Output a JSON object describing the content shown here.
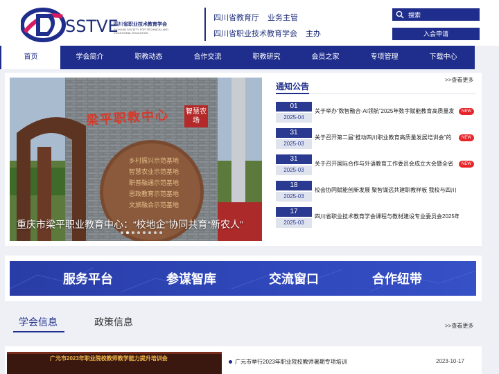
{
  "header": {
    "logo_word": "SSTVE",
    "logo_cn": "四川省职业技术教育学会",
    "logo_en": "SICHUAN SOCIETY FOR TECHNICAL AND VOCATIONAL EDUCATION",
    "line1_org": "四川省教育厅",
    "line1_rel": "业务主管",
    "line2_org": "四川省职业技术教育学会",
    "line2_rel": "主办",
    "search_placeholder": "搜索",
    "join_label": "入会申请"
  },
  "nav": {
    "items": [
      {
        "label": "首页",
        "active": true
      },
      {
        "label": "学会简介"
      },
      {
        "label": "职教动态"
      },
      {
        "label": "合作交流"
      },
      {
        "label": "职教研究"
      },
      {
        "label": "会员之家"
      },
      {
        "label": "专项管理"
      },
      {
        "label": "下载中心"
      }
    ]
  },
  "slider": {
    "caption": "重庆市梁平职业教育中心：“校地企”协同共育“新农人”",
    "sign_text": "梁平职教中心",
    "sign_side": "智慧农场",
    "wall_lines": [
      "乡村振兴示范基地",
      "智慧农业示范基地",
      "职普融通示范基地",
      "思政教育示范基地",
      "文旅融合示范基地"
    ],
    "dot_count": 8,
    "active_dot": 1
  },
  "notice": {
    "title": "通知公告",
    "more": ">>查看更多",
    "items": [
      {
        "day": "01",
        "ym": "2025-04",
        "text": "关于举办“数智融合·AI领航”2025年数字赋能教育高质量发",
        "new": true
      },
      {
        "day": "31",
        "ym": "2025-03",
        "text": "关于召开第二届“推动四川职业教育高质量发展培训会”的",
        "new": true
      },
      {
        "day": "31",
        "ym": "2025-03",
        "text": "关于召开国际合作与外语教育工作委员会成立大会暨全省",
        "new": true
      },
      {
        "day": "18",
        "ym": "2025-03",
        "text": "校会协同赋能创新发展 聚智谋远共建职教样板 我校与四川",
        "new": false
      },
      {
        "day": "17",
        "ym": "2025-03",
        "text": "四川省职业技术教育学会课程与教材建设专业委员会2025年",
        "new": false
      }
    ],
    "new_label": "NEW"
  },
  "banner": {
    "items": [
      "服务平台",
      "参谋智库",
      "交流窗口",
      "合作纽带"
    ]
  },
  "tabs": {
    "items": [
      "学会信息",
      "政策信息"
    ],
    "more": ">>查看更多"
  },
  "news": {
    "image_text": "广元市2023年职业院校教师教学能力提升培训会",
    "title": "广元市举行2023年职业院校教师暑期专项培训",
    "date": "2023-10-17"
  },
  "colors": {
    "brand": "#1f2e8c",
    "new_badge": "#e5252a"
  }
}
